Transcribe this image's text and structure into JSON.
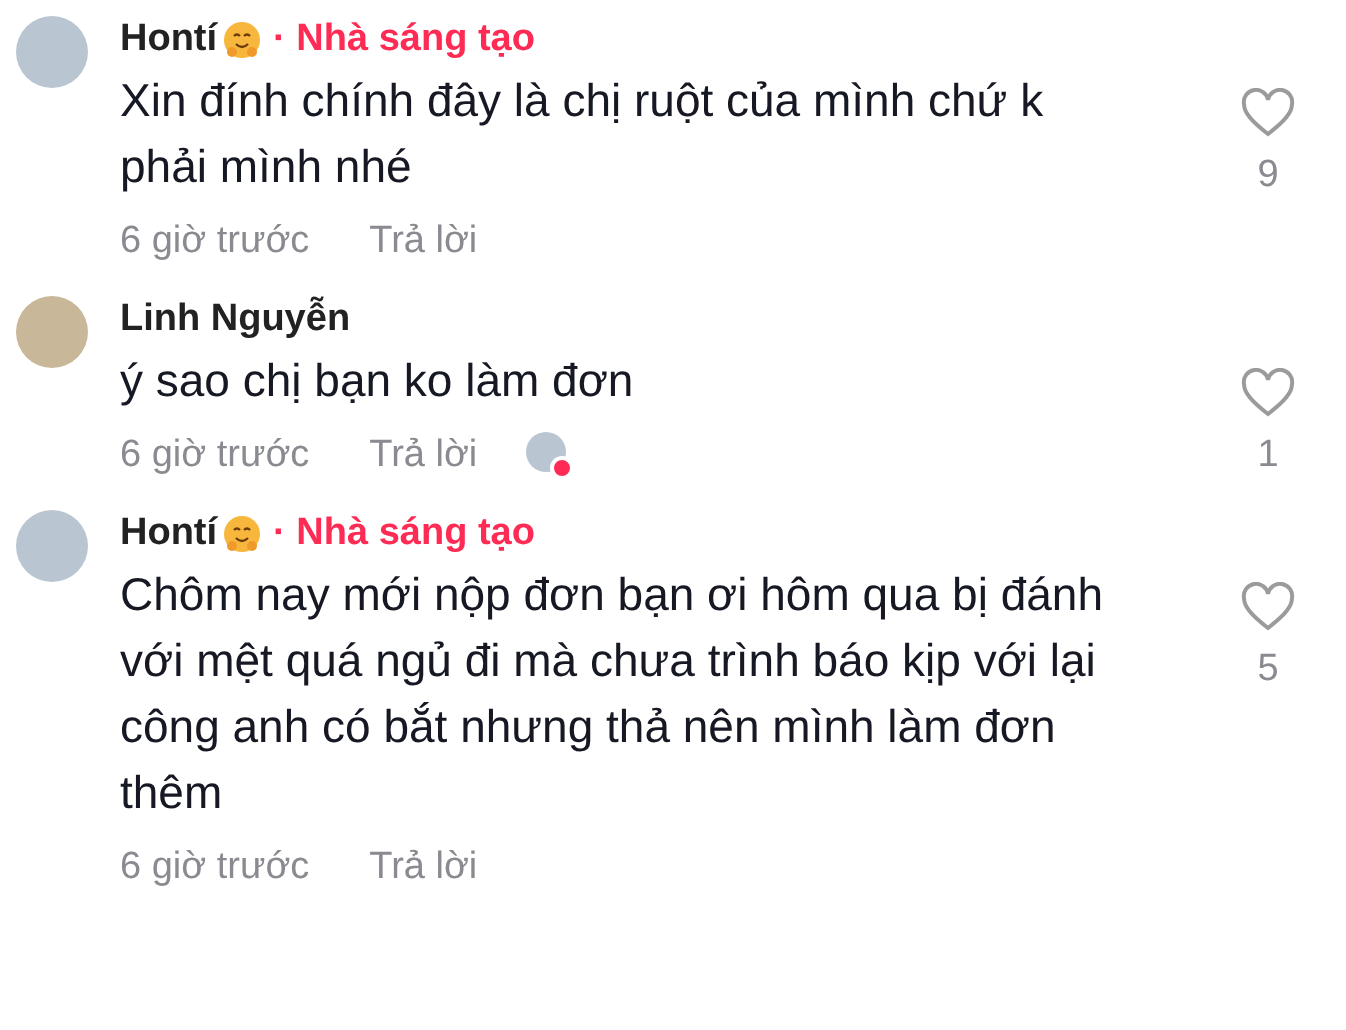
{
  "comments": [
    {
      "kind": "photo",
      "author": "Hontí",
      "emoji": true,
      "badge": "· Nhà sáng tạo",
      "body": "Xin đính chính đây là chị ruột của mình chứ k phải mình nhé",
      "time": "6 giờ trước",
      "reply": "Trả lời",
      "liked_by_creator": false,
      "likes": "9"
    },
    {
      "kind": "drawing",
      "author": "Linh Nguyễn",
      "emoji": false,
      "body": "ý sao chị bạn ko làm đơn",
      "time": "6 giờ trước",
      "reply": "Trả lời",
      "liked_by_creator": true,
      "likes": "1"
    },
    {
      "kind": "photo",
      "author": "Hontí",
      "emoji": true,
      "badge": "· Nhà sáng tạo",
      "body": "Chôm nay mới nộp đơn bạn ơi hôm qua bị đánh với mệt quá ngủ đi mà chưa trình báo kịp với lại công anh có bắt nhưng thả nên mình làm đơn thêm",
      "time": "6 giờ trước",
      "reply": "Trả lời",
      "liked_by_creator": false,
      "likes": "5"
    }
  ]
}
